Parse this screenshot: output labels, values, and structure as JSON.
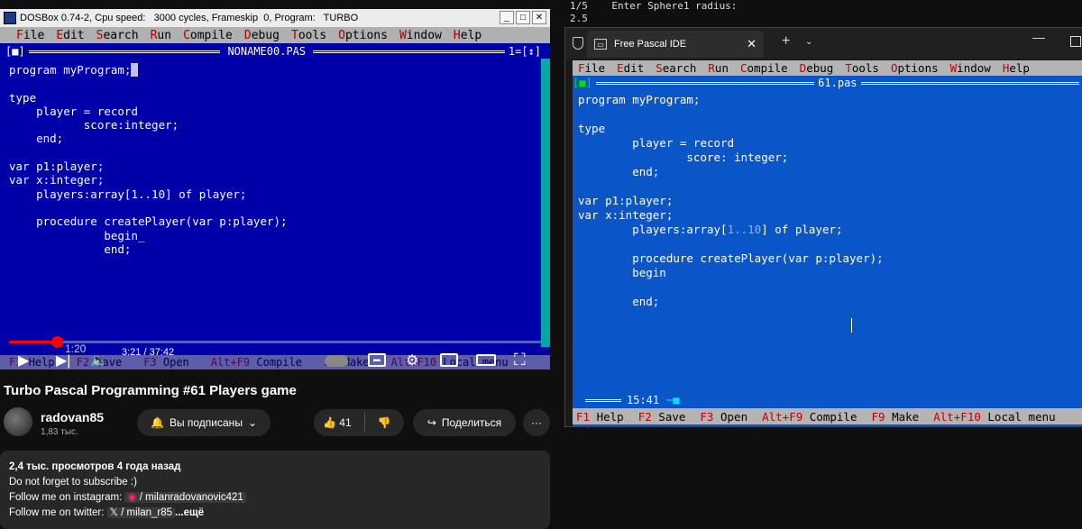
{
  "terminal": {
    "line1": "1/5    Enter Sphere1 radius:",
    "line2": "2.5"
  },
  "dosbox": {
    "title": "DOSBox 0.74-2, Cpu speed:   3000 cycles, Frameskip  0, Program:   TURBO",
    "menu": [
      "File",
      "Edit",
      "Search",
      "Run",
      "Compile",
      "Debug",
      "Tools",
      "Options",
      "Window",
      "Help"
    ],
    "frame_left": "[■]",
    "filename": "NONAME00.PAS",
    "frame_right": "1=[↕]",
    "code": {
      "l1": "program myProgram;",
      "l2": "",
      "l3": "type",
      "l4": "    player = record",
      "l5": "           score:integer;",
      "l6": "    end;",
      "l7": "",
      "l8": "var p1:player;",
      "l9": "var x:integer;",
      "l10": "    players:array[1..10] of player;",
      "l11": "",
      "l12": "    procedure createPlayer(var p:player);",
      "l13": "              begin_",
      "l14": "              end;"
    },
    "status": [
      {
        "key": "F1",
        "label": "Help"
      },
      {
        "key": "F2",
        "label": "Save"
      },
      {
        "key": "F3",
        "label": "Open"
      },
      {
        "key": "Alt+F9",
        "label": "Compile"
      },
      {
        "key": "F9",
        "label": "Make"
      },
      {
        "key": "Alt+F10",
        "label": "Local menu"
      }
    ]
  },
  "player": {
    "current_time": "3:21",
    "duration": "37:42",
    "time_text": "3:21 / 37:42",
    "progress": 0.089,
    "partial_timestamp": "1:20"
  },
  "video": {
    "title": "Turbo Pascal Programming #61 Players game",
    "channel": "radovan85",
    "subscribers": "1,83 тыс.",
    "subscribe_label": "Вы подписаны",
    "likes": "41",
    "share_label": "Поделиться",
    "more_label": "···"
  },
  "description": {
    "stats": "2,4 тыс. просмотров  4 года назад",
    "line1": "Do not forget to subscribe :)",
    "line2_prefix": "Follow me on instagram:",
    "line2_link": "/ milanradovanovic421",
    "line3_prefix": "Follow me on twitter:",
    "line3_link": "/ milan_r85",
    "more": "...ещё"
  },
  "fpide": {
    "tab_title": "Free Pascal IDE",
    "new_tab": "+",
    "menu": [
      "File",
      "Edit",
      "Search",
      "Run",
      "Compile",
      "Debug",
      "Tools",
      "Options",
      "Window",
      "Help"
    ],
    "frame_left": "[■]",
    "filename": "61.pas",
    "code": {
      "l1": "program myProgram;",
      "l2": "",
      "l3": "type",
      "l4": "        player = record",
      "l5": "                score: integer;",
      "l6": "        end;",
      "l7": "",
      "l8": "var p1:player;",
      "l9": "var x:integer;",
      "l10a": "        players:array[",
      "l10b": "1..10",
      "l10c": "] of player;",
      "l11": "",
      "l12": "        procedure createPlayer(var p:player);",
      "l13": "        begin",
      "l14": "",
      "l15": "        end;"
    },
    "position": "15:41",
    "status": [
      {
        "key": "F1",
        "label": "Help"
      },
      {
        "key": "F2",
        "label": "Save"
      },
      {
        "key": "F3",
        "label": "Open"
      },
      {
        "key": "Alt+F9",
        "label": "Compile"
      },
      {
        "key": "F9",
        "label": "Make"
      },
      {
        "key": "Alt+F10",
        "label": "Local menu"
      }
    ]
  }
}
